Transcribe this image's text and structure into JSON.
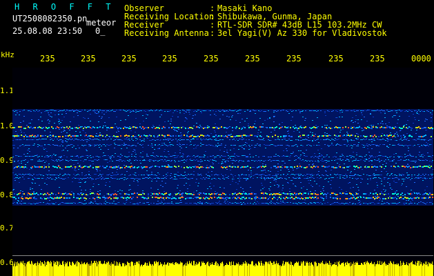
{
  "header": {
    "station_logo": "H R O F F T",
    "filename": "UT2508082350.pn",
    "tag": "meteor",
    "datetime": "25.08.08 23:50",
    "count": "0_",
    "info": [
      {
        "label": "Observer",
        "sep": ":",
        "value": "Masaki Kano"
      },
      {
        "label": "Receiving Location",
        "sep": ":",
        "value": "Shibukawa, Gunma, Japan"
      },
      {
        "label": "Receiver",
        "sep": ":",
        "value": "RTL-SDR SDR# 43dB L15 103.2MHz CW"
      },
      {
        "label": "Receiving Antenna",
        "sep": ":",
        "value": "3el Yagi(V) Az 330 for Vladivostok"
      }
    ]
  },
  "axis": {
    "y_unit": "kHz",
    "y_ticks": [
      "1.1",
      "1.0",
      "0.9",
      "0.8",
      "0.7",
      "0.6"
    ],
    "time_ticks": [
      "235",
      "235",
      "235",
      "235",
      "235",
      "235",
      "235",
      "235",
      "235",
      "0000"
    ]
  },
  "colors": {
    "text_yellow": "#ffff00",
    "text_cyan": "#00ffff",
    "background": "#000000",
    "spectrogram_bg": "#000c40"
  }
}
